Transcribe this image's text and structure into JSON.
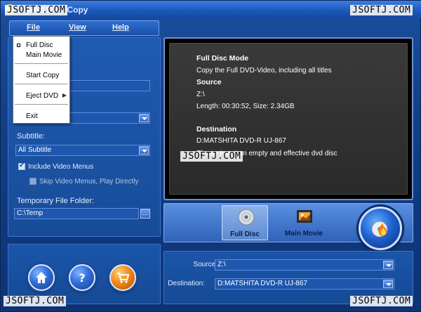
{
  "window": {
    "title": "Tipard DVD Copy",
    "close_glyph": "✕",
    "icon": "app-disc-icon"
  },
  "watermarks": {
    "top_left": "JSOFTJ.COM",
    "top_right": "JSOFTJ.COM",
    "middle": "JSOFTJ.COM",
    "bottom_left": "JSOFTJ.COM",
    "bottom_right": "JSOFTJ.COM"
  },
  "menubar": {
    "file": "File",
    "view": "View",
    "help": "Help"
  },
  "file_menu": {
    "items": [
      "Full Disc",
      "Main Movie",
      "Start Copy",
      "Eject DVD",
      "Exit"
    ],
    "selected": "Full Disc",
    "submenu_glyph": "▶"
  },
  "left_panel": {
    "subtitle_label": "Subtitle:",
    "subtitle_value": "All Subtitle",
    "include_menus_label": "Include Video Menus",
    "include_menus_checked": true,
    "skip_menus_label": "Skip Video Menus, Play Directly",
    "skip_menus_checked": false,
    "temp_folder_label": "Temporary File Folder:",
    "temp_folder_value": "C:\\Temp",
    "browse_glyph": "..."
  },
  "info": {
    "mode_heading": "Full Disc Mode",
    "mode_desc": "Copy the Full DVD-Video, including all titles",
    "source_heading": "Source",
    "source_path": "Z:\\",
    "source_details": "Length: 00:30:52, Size: 2.34GB",
    "dest_heading": "Destination",
    "dest_device": "D:MATSHITA DVD-R   UJ-867",
    "dest_message": "Please insert an empty and effective dvd disc"
  },
  "modes": {
    "full_disc": "Full Disc",
    "main_movie": "Main Movie",
    "active": "full_disc"
  },
  "io": {
    "source_label": "Source:",
    "source_value": "Z:\\",
    "destination_label": "Destination:",
    "destination_value": "D:MATSHITA DVD-R   UJ-867"
  },
  "colors": {
    "panel_blue": "#1e5bb0",
    "info_bg": "#2a2a2a",
    "accent_orange": "#f08a1a"
  }
}
